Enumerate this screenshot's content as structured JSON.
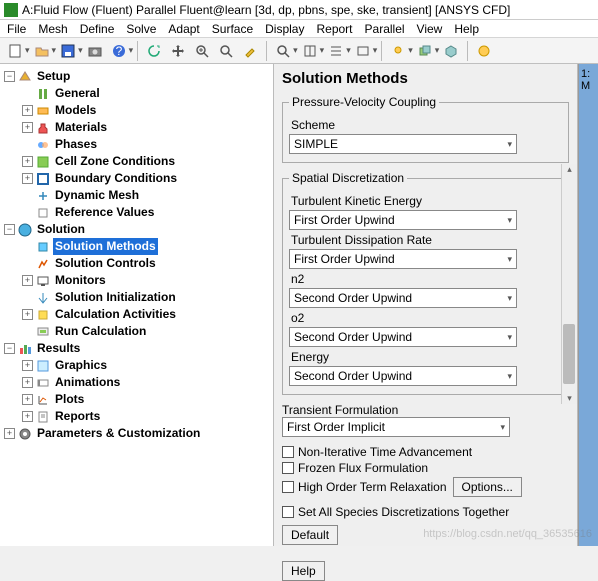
{
  "window": {
    "title": "A:Fluid Flow (Fluent) Parallel Fluent@learn  [3d, dp, pbns, spe, ske, transient] [ANSYS CFD]"
  },
  "menu": [
    "File",
    "Mesh",
    "Define",
    "Solve",
    "Adapt",
    "Surface",
    "Display",
    "Report",
    "Parallel",
    "View",
    "Help"
  ],
  "side_tab": "1: M",
  "tree": {
    "setup": {
      "label": "Setup",
      "expanded": true,
      "children": [
        {
          "label": "General"
        },
        {
          "label": "Models",
          "expandable": true
        },
        {
          "label": "Materials",
          "expandable": true
        },
        {
          "label": "Phases"
        },
        {
          "label": "Cell Zone Conditions",
          "expandable": true
        },
        {
          "label": "Boundary Conditions",
          "expandable": true
        },
        {
          "label": "Dynamic Mesh"
        },
        {
          "label": "Reference Values"
        }
      ]
    },
    "solution": {
      "label": "Solution",
      "expanded": true,
      "children": [
        {
          "label": "Solution Methods",
          "selected": true
        },
        {
          "label": "Solution Controls"
        },
        {
          "label": "Monitors",
          "expandable": true
        },
        {
          "label": "Solution Initialization"
        },
        {
          "label": "Calculation Activities",
          "expandable": true
        },
        {
          "label": "Run Calculation"
        }
      ]
    },
    "results": {
      "label": "Results",
      "expanded": true,
      "children": [
        {
          "label": "Graphics",
          "expandable": true
        },
        {
          "label": "Animations",
          "expandable": true
        },
        {
          "label": "Plots",
          "expandable": true
        },
        {
          "label": "Reports",
          "expandable": true
        }
      ]
    },
    "params": {
      "label": "Parameters & Customization",
      "expandable": true
    }
  },
  "panel": {
    "title": "Solution Methods",
    "pvc": {
      "legend": "Pressure-Velocity Coupling",
      "scheme_label": "Scheme",
      "scheme_value": "SIMPLE"
    },
    "sd": {
      "legend": "Spatial Discretization",
      "items": [
        {
          "label": "Turbulent Kinetic Energy",
          "value": "First Order Upwind"
        },
        {
          "label": "Turbulent Dissipation Rate",
          "value": "First Order Upwind"
        },
        {
          "label": "n2",
          "value": "Second Order Upwind"
        },
        {
          "label": "o2",
          "value": "Second Order Upwind"
        },
        {
          "label": "Energy",
          "value": "Second Order Upwind"
        }
      ]
    },
    "tf": {
      "legend": "Transient Formulation",
      "value": "First Order Implicit"
    },
    "checks": {
      "nita": "Non-Iterative Time Advancement",
      "ffx": "Frozen Flux Formulation",
      "hotr": "High Order Term Relaxation",
      "options_btn": "Options...",
      "setall": "Set All Species Discretizations Together"
    },
    "default_btn": "Default",
    "help_btn": "Help"
  },
  "watermark": "https://blog.csdn.net/qq_36535616"
}
